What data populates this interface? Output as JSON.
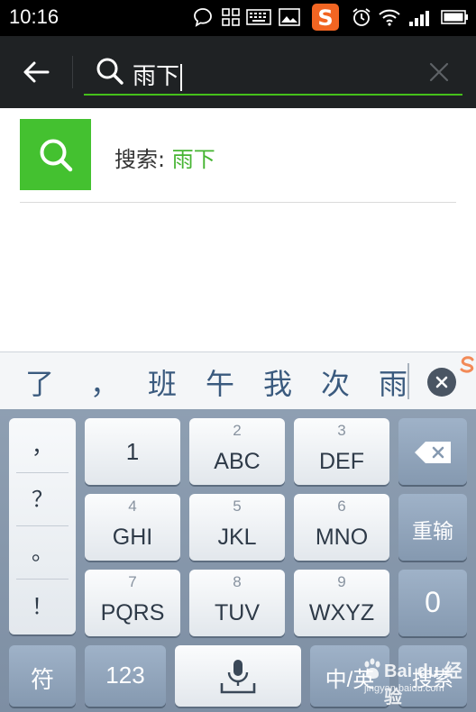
{
  "status_bar": {
    "time": "10:16",
    "icons": [
      "chat-bubble-icon",
      "grid-apps-icon",
      "keyboard-icon",
      "image-icon",
      "sogou-s-icon",
      "alarm-icon",
      "wifi-icon",
      "signal-icon",
      "battery-icon"
    ],
    "sogou_letter": "S",
    "sogou_color": "#f26522"
  },
  "toolbar": {
    "search_query": "雨下"
  },
  "result": {
    "prefix": "搜索: ",
    "query": "雨下",
    "accent_color": "#44c130"
  },
  "candidates": [
    "了",
    "，",
    "班",
    "午",
    "我",
    "次",
    "雨"
  ],
  "keyboard": {
    "punctuation": [
      "，",
      "？",
      "。",
      "！"
    ],
    "rows": [
      [
        {
          "num": "",
          "label": "1"
        },
        {
          "num": "2",
          "label": "ABC"
        },
        {
          "num": "3",
          "label": "DEF"
        }
      ],
      [
        {
          "num": "4",
          "label": "GHI"
        },
        {
          "num": "5",
          "label": "JKL"
        },
        {
          "num": "6",
          "label": "MNO"
        }
      ],
      [
        {
          "num": "7",
          "label": "PQRS"
        },
        {
          "num": "8",
          "label": "TUV"
        },
        {
          "num": "9",
          "label": "WXYZ"
        }
      ]
    ],
    "side_keys": {
      "retype": "重输",
      "zero": "0"
    },
    "bottom": {
      "symbols": "符",
      "numbers": "123",
      "lang": "中/英",
      "search": "搜索"
    }
  },
  "watermark": {
    "text": "Bai du 经验",
    "url": "jingyan.baidu.com"
  }
}
